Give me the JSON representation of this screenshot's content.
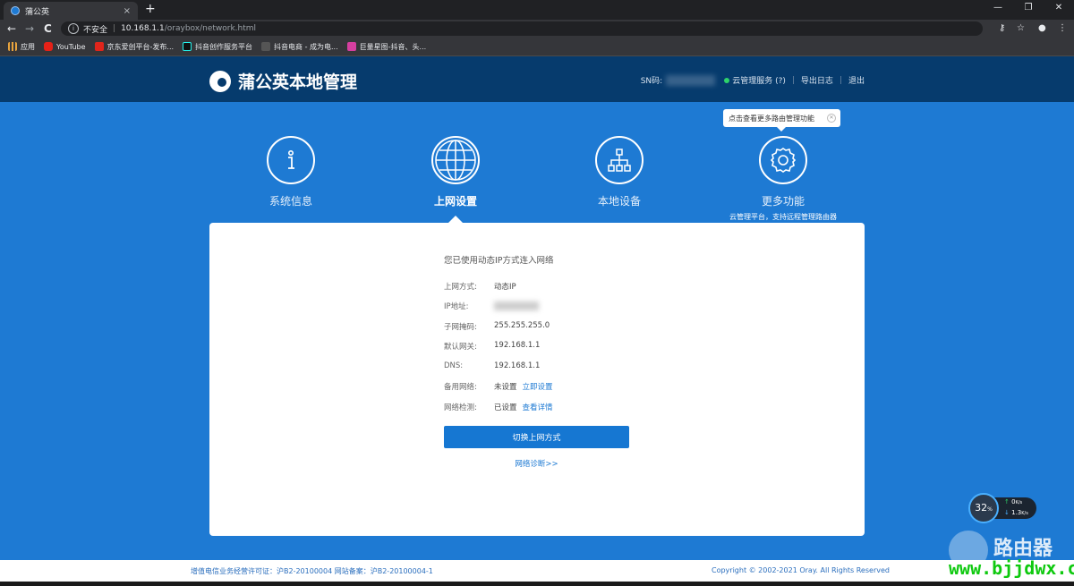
{
  "browser": {
    "tab_title": "蒲公英",
    "tab_close": "×",
    "new_tab": "+",
    "win_min": "—",
    "win_max": "❐",
    "win_close": "✕",
    "back": "←",
    "forward": "→",
    "reload": "C",
    "security_label": "不安全",
    "url_host": "10.168.1.1",
    "url_path": "/oraybox/network.html",
    "bookmarks": [
      "应用",
      "YouTube",
      "京东爱创平台-发布...",
      "抖音创作服务平台",
      "抖音电商 - 成为电...",
      "巨量星图-抖音、头..."
    ]
  },
  "header": {
    "brand": "蒲公英本地管理",
    "sn_label": "SN码:",
    "cloud_service": "云管理服务 (?)",
    "export_log": "导出日志",
    "logout": "退出",
    "divider": "|"
  },
  "tooltip": {
    "text": "点击查看更多路由管理功能"
  },
  "nav": {
    "system_info": "系统信息",
    "network_settings": "上网设置",
    "local_devices": "本地设备",
    "more_features": "更多功能",
    "more_features_sub": "云管理平台，支持远程管理路由器"
  },
  "panel": {
    "title": "您已使用动态IP方式连入网络",
    "rows": [
      {
        "label": "上网方式:",
        "value": "动态IP"
      },
      {
        "label": "IP地址:",
        "value": ""
      },
      {
        "label": "子网掩码:",
        "value": "255.255.255.0"
      },
      {
        "label": "默认网关:",
        "value": "192.168.1.1"
      },
      {
        "label": "DNS:",
        "value": "192.168.1.1"
      },
      {
        "label": "备用网络:",
        "value": "未设置",
        "link": "立即设置"
      },
      {
        "label": "网络检测:",
        "value": "已设置",
        "link": "查看详情"
      }
    ],
    "switch_button": "切换上网方式",
    "diagnose_link": "网络诊断>>"
  },
  "footer": {
    "license": "增值电信业务经营许可证：沪B2-20100004 网站备案：沪B2-20100004-1",
    "copyright": "Copyright © 2002-2021 Oray. All Rights Reserved"
  },
  "speed_widget": {
    "percent": "32",
    "percent_unit": "%",
    "upload": "0",
    "upload_unit": "K/s",
    "download": "1.3",
    "download_unit": "K/s"
  },
  "watermark": {
    "title": "路由器",
    "url": "www.bjjdwx.com"
  },
  "colors": {
    "brand_blue": "#1e7ad3",
    "header_navy": "#063b6d",
    "online_green": "#2ed36a"
  }
}
